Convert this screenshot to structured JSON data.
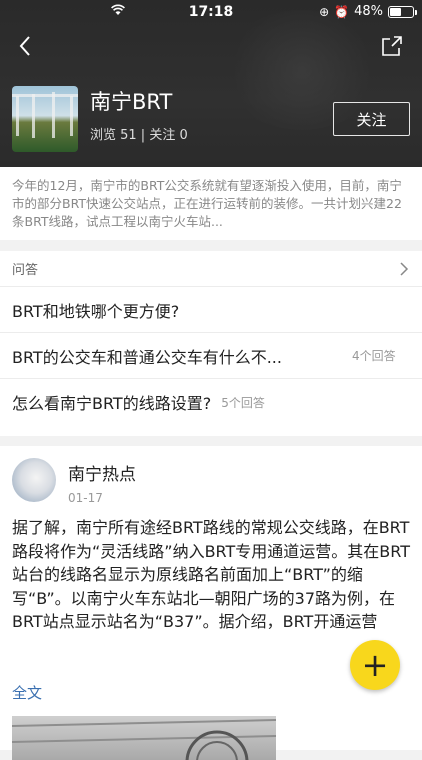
{
  "status_bar": {
    "time": "17:18",
    "battery": "48%"
  },
  "topic": {
    "title": "南宁BRT",
    "meta": "浏览 51 | 关注 0",
    "follow_label": "关注",
    "description": "今年的12月，南宁市的BRT公交系统就有望逐渐投入使用，目前，南宁市的部分BRT快速公交站点，正在进行运转前的装修。一共计划兴建22条BRT线路，试点工程以南宁火车站..."
  },
  "qa": {
    "header": "问答",
    "items": [
      {
        "question": "BRT和地铁哪个更方便?",
        "count": ""
      },
      {
        "question": "BRT的公交车和普通公交车有什么不...",
        "count": "4个回答"
      },
      {
        "question": "怎么看南宁BRT的线路设置?",
        "count": "5个回答"
      }
    ]
  },
  "post": {
    "author": "南宁热点",
    "date": "01-17",
    "body": "据了解，南宁所有途经BRT路线的常规公交线路，在BRT路段将作为“灵活线路”纳入BRT专用通道运营。其在BRT站台的线路名显示为原线路名前面加上“BRT”的缩写“B”。以南宁火车东站北—朝阳广场的37路为例，在BRT站点显示站名为“B37”。据介绍，BRT开通运营",
    "more_label": "全文"
  },
  "fab_label": "+",
  "icons": {
    "back": "back-arrow-icon",
    "share": "share-icon",
    "wifi": "wifi-icon",
    "chevron": "chevron-right-icon"
  }
}
